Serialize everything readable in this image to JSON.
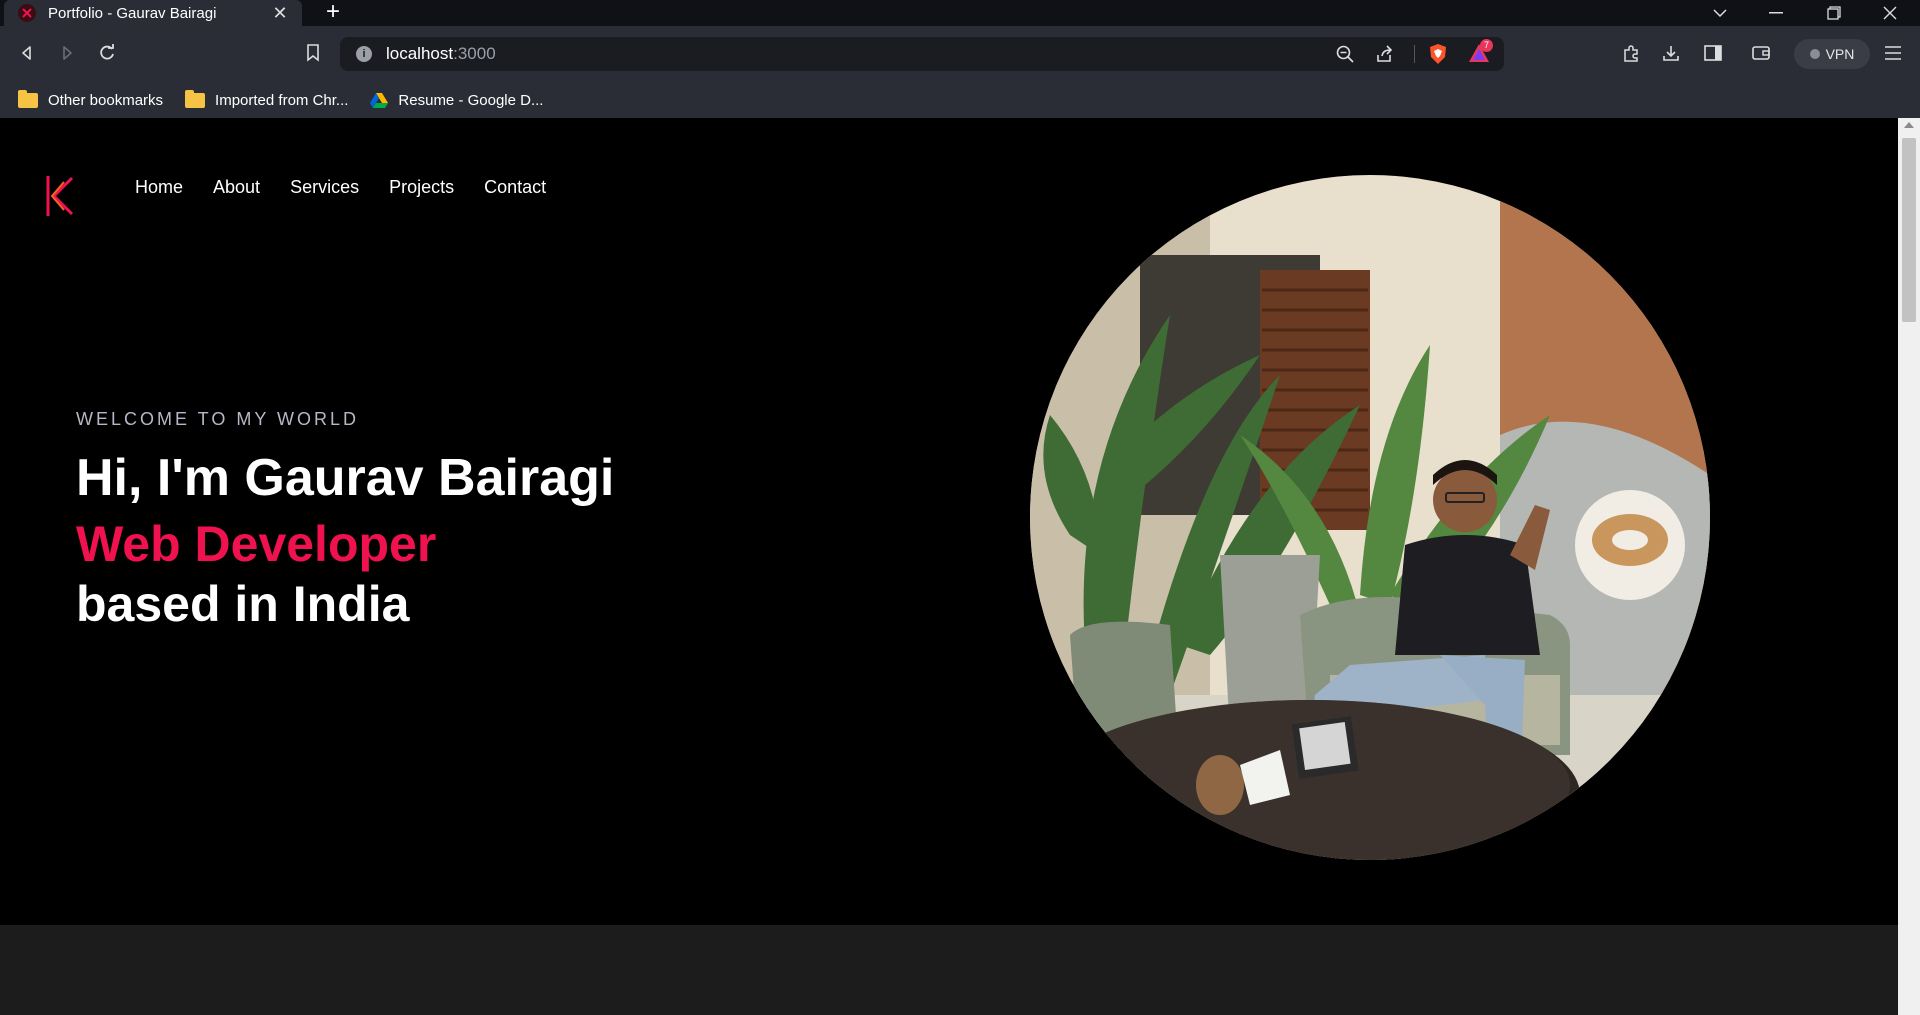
{
  "browser": {
    "tab_title": "Portfolio - Gaurav Bairagi",
    "new_tab": "+",
    "url_host": "localhost",
    "url_port": ":3000",
    "vpn_label": "VPN",
    "brave_badge": "7",
    "bookmarks": [
      {
        "label": "Other bookmarks"
      },
      {
        "label": "Imported from Chr..."
      },
      {
        "label": "Resume - Google D..."
      }
    ]
  },
  "page": {
    "nav": [
      "Home",
      "About",
      "Services",
      "Projects",
      "Contact"
    ],
    "welcome": "WELCOME TO MY WORLD",
    "greeting": "Hi, I'm Gaurav Bairagi",
    "role": "Web Developer",
    "location": "based in India"
  },
  "colors": {
    "accent": "#f0124e",
    "page_bg": "#000000",
    "chrome_bg": "#2a2d36"
  }
}
